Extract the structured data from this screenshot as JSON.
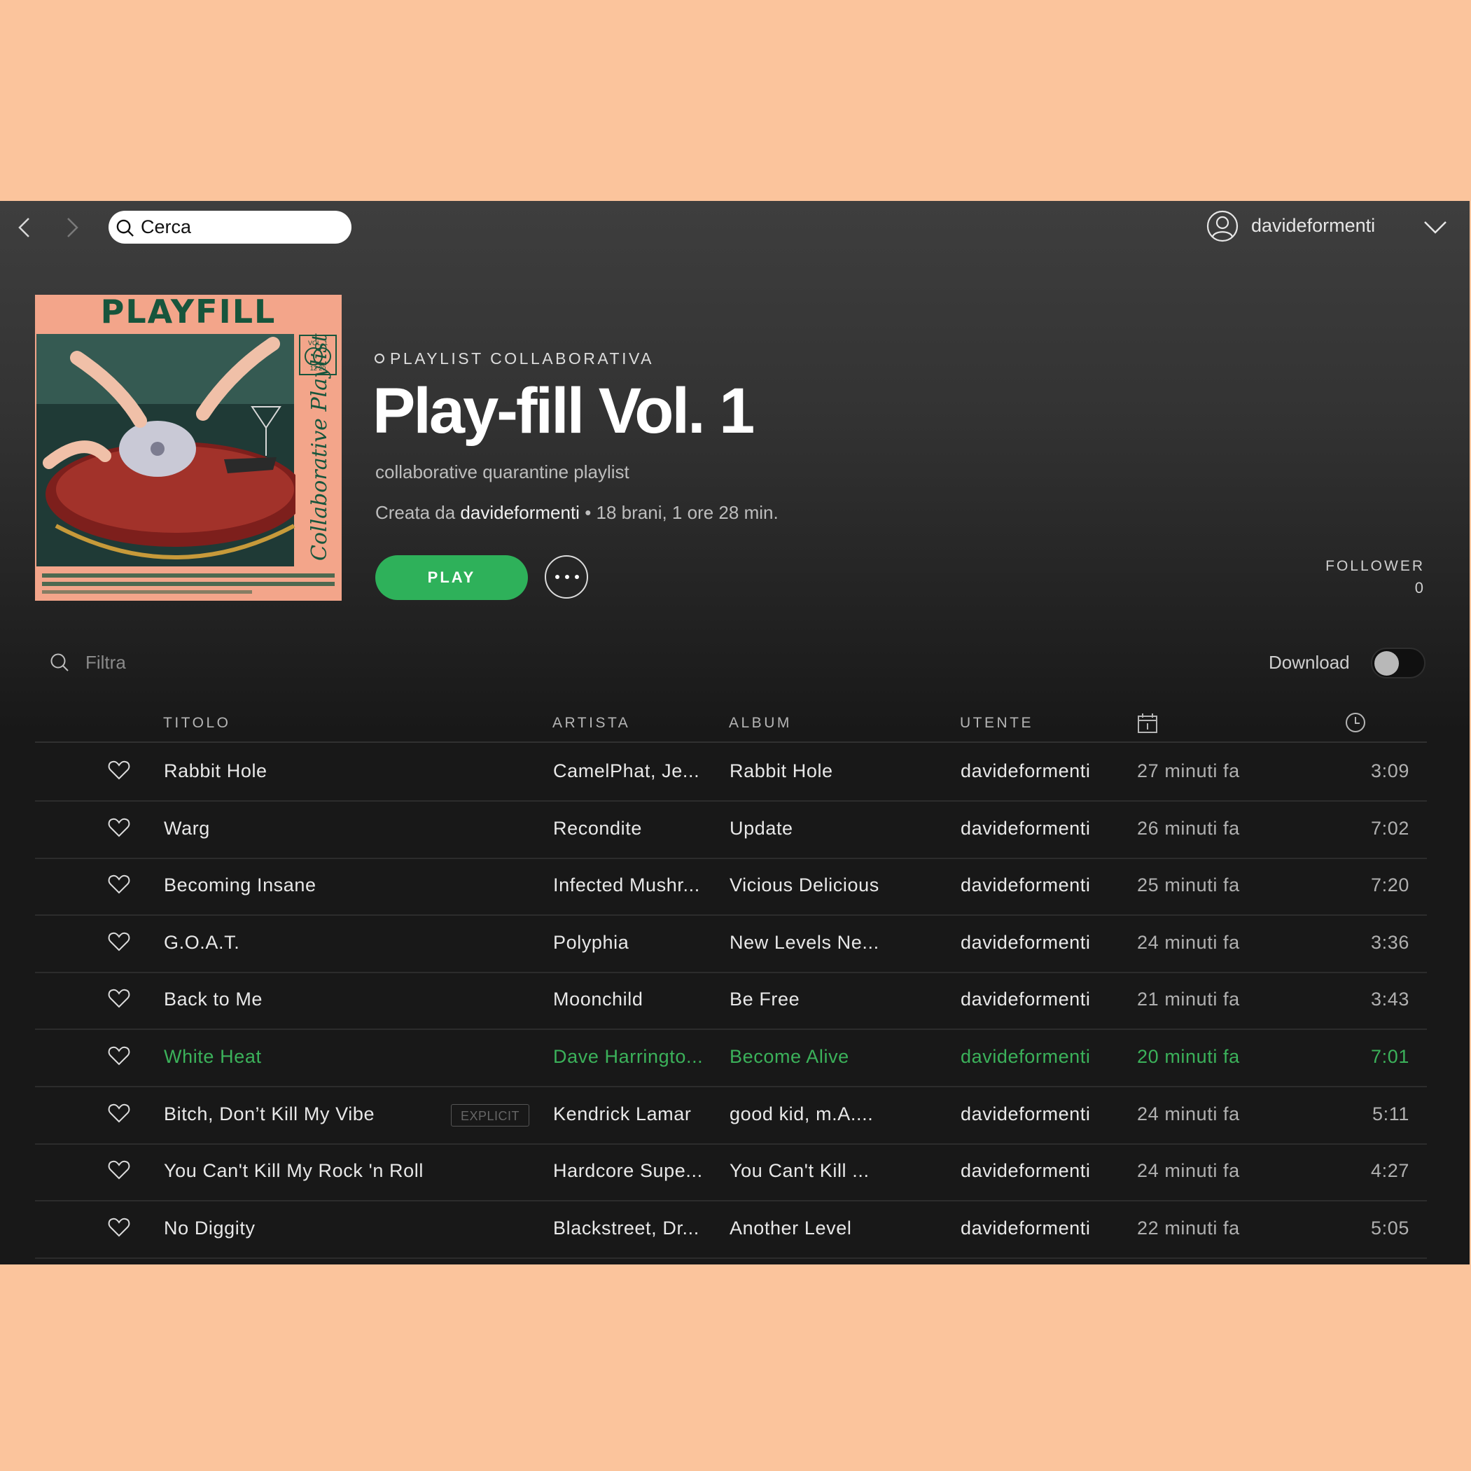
{
  "search": {
    "placeholder": "Cerca"
  },
  "user": {
    "name": "davideformenti"
  },
  "playlist": {
    "type": "PLAYLIST COLLABORATIVA",
    "title": "Play-fill Vol. 1",
    "description": "collaborative quarantine playlist",
    "created_by_prefix": "Creata da",
    "creator": "davideformenti",
    "stats": "• 18 brani, 1 ore 28 min.",
    "play_label": "PLAY",
    "follower_label": "FOLLOWER",
    "follower_count": "0",
    "cover": {
      "title": "PLAYFILL",
      "side_text": "Collaborative Playlist",
      "vol": "VOL. 1",
      "issue": "12 20"
    }
  },
  "filter": {
    "placeholder": "Filtra"
  },
  "download": {
    "label": "Download",
    "enabled": false
  },
  "columns": {
    "title": "TITOLO",
    "artist": "ARTISTA",
    "album": "ALBUM",
    "user": "UTENTE",
    "added_icon": "calendar-icon",
    "duration_icon": "clock-icon"
  },
  "colors": {
    "accent": "#2eb15a",
    "background": "#fbc49c",
    "window": "#181818"
  },
  "tracks": [
    {
      "title": "Rabbit Hole",
      "artist": "CamelPhat, Je...",
      "album": "Rabbit Hole",
      "user": "davideformenti",
      "added": "27 minuti fa",
      "duration": "3:09"
    },
    {
      "title": "Warg",
      "artist": "Recondite",
      "album": "Update",
      "user": "davideformenti",
      "added": "26 minuti fa",
      "duration": "7:02"
    },
    {
      "title": "Becoming Insane",
      "artist": "Infected Mushr...",
      "album": "Vicious Delicious",
      "user": "davideformenti",
      "added": "25 minuti fa",
      "duration": "7:20"
    },
    {
      "title": "G.O.A.T.",
      "artist": "Polyphia",
      "album": "New Levels Ne...",
      "user": "davideformenti",
      "added": "24 minuti fa",
      "duration": "3:36"
    },
    {
      "title": "Back to Me",
      "artist": "Moonchild",
      "album": "Be Free",
      "user": "davideformenti",
      "added": "21 minuti fa",
      "duration": "3:43"
    },
    {
      "title": "White Heat",
      "artist": "Dave Harringto...",
      "album": "Become Alive",
      "user": "davideformenti",
      "added": "20 minuti fa",
      "duration": "7:01",
      "playing": true
    },
    {
      "title": "Bitch, Don’t Kill My Vibe",
      "explicit": "EXPLICIT",
      "artist": "Kendrick Lamar",
      "album": "good kid, m.A....",
      "user": "davideformenti",
      "added": "24 minuti fa",
      "duration": "5:11"
    },
    {
      "title": "You Can't Kill My Rock 'n Roll",
      "artist": "Hardcore Supe...",
      "album": "You Can't Kill ...",
      "user": "davideformenti",
      "added": "24 minuti fa",
      "duration": "4:27"
    },
    {
      "title": "No Diggity",
      "artist": "Blackstreet, Dr...",
      "album": "Another Level",
      "user": "davideformenti",
      "added": "22 minuti fa",
      "duration": "5:05"
    }
  ]
}
